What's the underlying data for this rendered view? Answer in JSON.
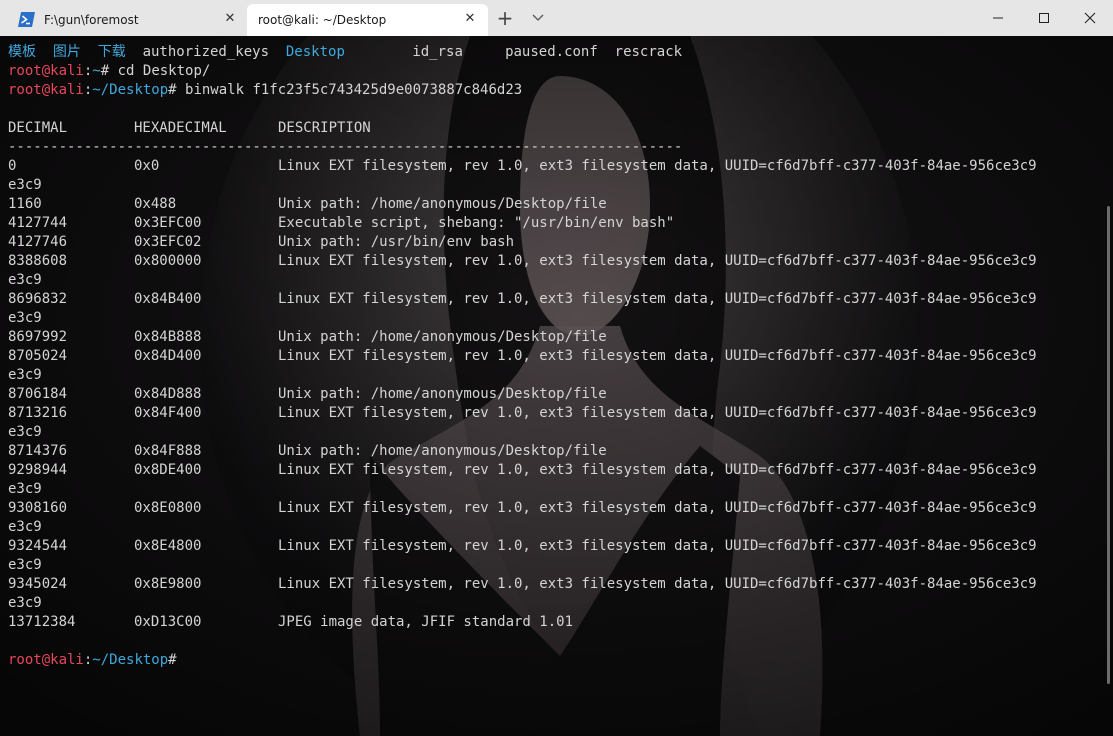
{
  "tabs": [
    {
      "title": "F:\\gun\\foremost",
      "icon": "powershell-icon",
      "active": false
    },
    {
      "title": "root@kali: ~/Desktop",
      "icon": "",
      "active": true
    }
  ],
  "tabbar": {
    "new_tab": "+",
    "close_glyph": "✕"
  },
  "colors": {
    "prompt_user": "#e5475c",
    "prompt_path": "#3fa8dc",
    "text": "#d4d4d4",
    "tab_active_bg": "#ffffff",
    "tabbar_bg": "#e6e6e6"
  },
  "terminal": {
    "ls_output": {
      "folders": [
        "模板",
        "图片",
        "下载"
      ],
      "items": [
        "authorized_keys",
        "Desktop",
        "id_rsa",
        "paused.conf",
        "rescrack"
      ]
    },
    "prompt_user": "root@kali",
    "prompt_sep": ":",
    "cmd1": {
      "path": "~",
      "symbol": "#",
      "command": " cd Desktop/"
    },
    "cmd2": {
      "path": "~/Desktop",
      "symbol": "#",
      "command": " binwalk f1fc23f5c743425d9e0073887c846d23"
    },
    "final_prompt": {
      "path": "~/Desktop",
      "symbol": "#"
    },
    "table": {
      "headers": [
        "DECIMAL",
        "HEXADECIMAL",
        "DESCRIPTION"
      ],
      "separator": "--------------------------------------------------------------------------------",
      "rows": [
        {
          "dec": "0",
          "hex": "0x0",
          "desc": "Linux EXT filesystem, rev 1.0, ext3 filesystem data, UUID=cf6d7bff-c377-403f-84ae-956ce3c9",
          "wrap": "e3c9"
        },
        {
          "dec": "1160",
          "hex": "0x488",
          "desc": "Unix path: /home/anonymous/Desktop/file",
          "wrap": ""
        },
        {
          "dec": "4127744",
          "hex": "0x3EFC00",
          "desc": "Executable script, shebang: \"/usr/bin/env bash\"",
          "wrap": ""
        },
        {
          "dec": "4127746",
          "hex": "0x3EFC02",
          "desc": "Unix path: /usr/bin/env bash",
          "wrap": ""
        },
        {
          "dec": "8388608",
          "hex": "0x800000",
          "desc": "Linux EXT filesystem, rev 1.0, ext3 filesystem data, UUID=cf6d7bff-c377-403f-84ae-956ce3c9",
          "wrap": "e3c9"
        },
        {
          "dec": "8696832",
          "hex": "0x84B400",
          "desc": "Linux EXT filesystem, rev 1.0, ext3 filesystem data, UUID=cf6d7bff-c377-403f-84ae-956ce3c9",
          "wrap": "e3c9"
        },
        {
          "dec": "8697992",
          "hex": "0x84B888",
          "desc": "Unix path: /home/anonymous/Desktop/file",
          "wrap": ""
        },
        {
          "dec": "8705024",
          "hex": "0x84D400",
          "desc": "Linux EXT filesystem, rev 1.0, ext3 filesystem data, UUID=cf6d7bff-c377-403f-84ae-956ce3c9",
          "wrap": "e3c9"
        },
        {
          "dec": "8706184",
          "hex": "0x84D888",
          "desc": "Unix path: /home/anonymous/Desktop/file",
          "wrap": ""
        },
        {
          "dec": "8713216",
          "hex": "0x84F400",
          "desc": "Linux EXT filesystem, rev 1.0, ext3 filesystem data, UUID=cf6d7bff-c377-403f-84ae-956ce3c9",
          "wrap": "e3c9"
        },
        {
          "dec": "8714376",
          "hex": "0x84F888",
          "desc": "Unix path: /home/anonymous/Desktop/file",
          "wrap": ""
        },
        {
          "dec": "9298944",
          "hex": "0x8DE400",
          "desc": "Linux EXT filesystem, rev 1.0, ext3 filesystem data, UUID=cf6d7bff-c377-403f-84ae-956ce3c9",
          "wrap": "e3c9"
        },
        {
          "dec": "9308160",
          "hex": "0x8E0800",
          "desc": "Linux EXT filesystem, rev 1.0, ext3 filesystem data, UUID=cf6d7bff-c377-403f-84ae-956ce3c9",
          "wrap": "e3c9"
        },
        {
          "dec": "9324544",
          "hex": "0x8E4800",
          "desc": "Linux EXT filesystem, rev 1.0, ext3 filesystem data, UUID=cf6d7bff-c377-403f-84ae-956ce3c9",
          "wrap": "e3c9"
        },
        {
          "dec": "9345024",
          "hex": "0x8E9800",
          "desc": "Linux EXT filesystem, rev 1.0, ext3 filesystem data, UUID=cf6d7bff-c377-403f-84ae-956ce3c9",
          "wrap": "e3c9"
        },
        {
          "dec": "13712384",
          "hex": "0xD13C00",
          "desc": "JPEG image data, JFIF standard 1.01",
          "wrap": ""
        }
      ]
    }
  }
}
